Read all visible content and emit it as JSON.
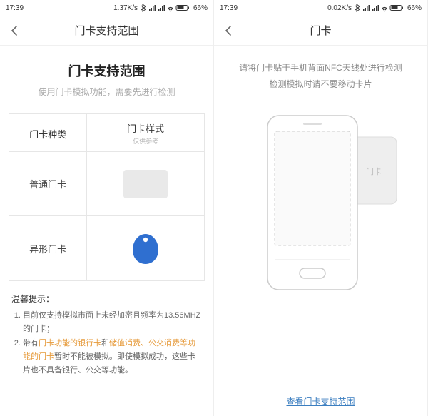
{
  "status": {
    "time": "17:39",
    "speed_left": "1.37K/s",
    "speed_right": "0.02K/s",
    "battery": "66%"
  },
  "left": {
    "nav_title": "门卡支持范围",
    "heading": "门卡支持范围",
    "subheading": "使用门卡模拟功能，需要先进行检测",
    "th_type": "门卡种类",
    "th_style": "门卡样式",
    "th_style_sub": "仅供参考",
    "row1_label": "普通门卡",
    "row2_label": "异形门卡",
    "tips_title": "温馨提示：",
    "tips_1_pre": "目前仅支持模拟市面上未经加密且频率为13.56MHZ的门卡；",
    "tips_2_a": "带有",
    "tips_2_b": "门卡功能的银行卡",
    "tips_2_c": "和",
    "tips_2_d": "储值消费、公交消费等功能的门卡",
    "tips_2_e": "暂时不能被模拟。即使模拟成功，这些卡片也不具备银行、公交等功能。"
  },
  "right": {
    "nav_title": "门卡",
    "instr_1": "请将门卡贴于手机背面NFC天线处进行检测",
    "instr_2": "检测模拟时请不要移动卡片",
    "card_label": "门卡",
    "link": "查看门卡支持范围"
  }
}
